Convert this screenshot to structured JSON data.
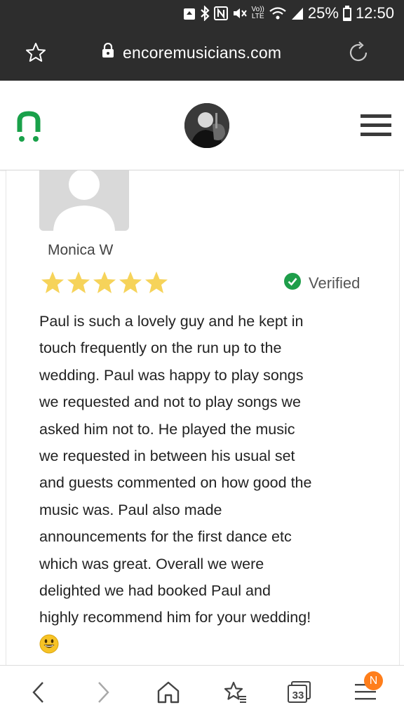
{
  "status_bar": {
    "battery": "25%",
    "time": "12:50",
    "volte": "Vo))",
    "lte": "LTE"
  },
  "browser": {
    "url": "encoremusicians.com"
  },
  "site_header": {
    "logo_letter": "n"
  },
  "review": {
    "reviewer_name": "Monica W",
    "rating": 5,
    "verified_label": "Verified",
    "text_lines": [
      "Paul is such a lovely guy and he kept in",
      "touch frequently on the run up to the",
      "wedding. Paul was happy to play songs",
      "we requested and not to play songs we",
      "asked him not to. He played the music",
      "we requested in between his usual set",
      "and guests commented on how good the",
      "music was. Paul also made",
      "announcements for the first dance etc",
      "which was great. Overall we were",
      "delighted we had booked Paul and",
      "highly recommend him for your wedding!"
    ]
  },
  "bottom_nav": {
    "tab_count": "33",
    "notification_badge": "N"
  },
  "colors": {
    "browser_bar": "#2d2d2d",
    "brand_green": "#19a14a",
    "star_yellow": "#f6d35a",
    "verified_green": "#1e9e4a",
    "badge_orange": "#ff7e1b"
  }
}
